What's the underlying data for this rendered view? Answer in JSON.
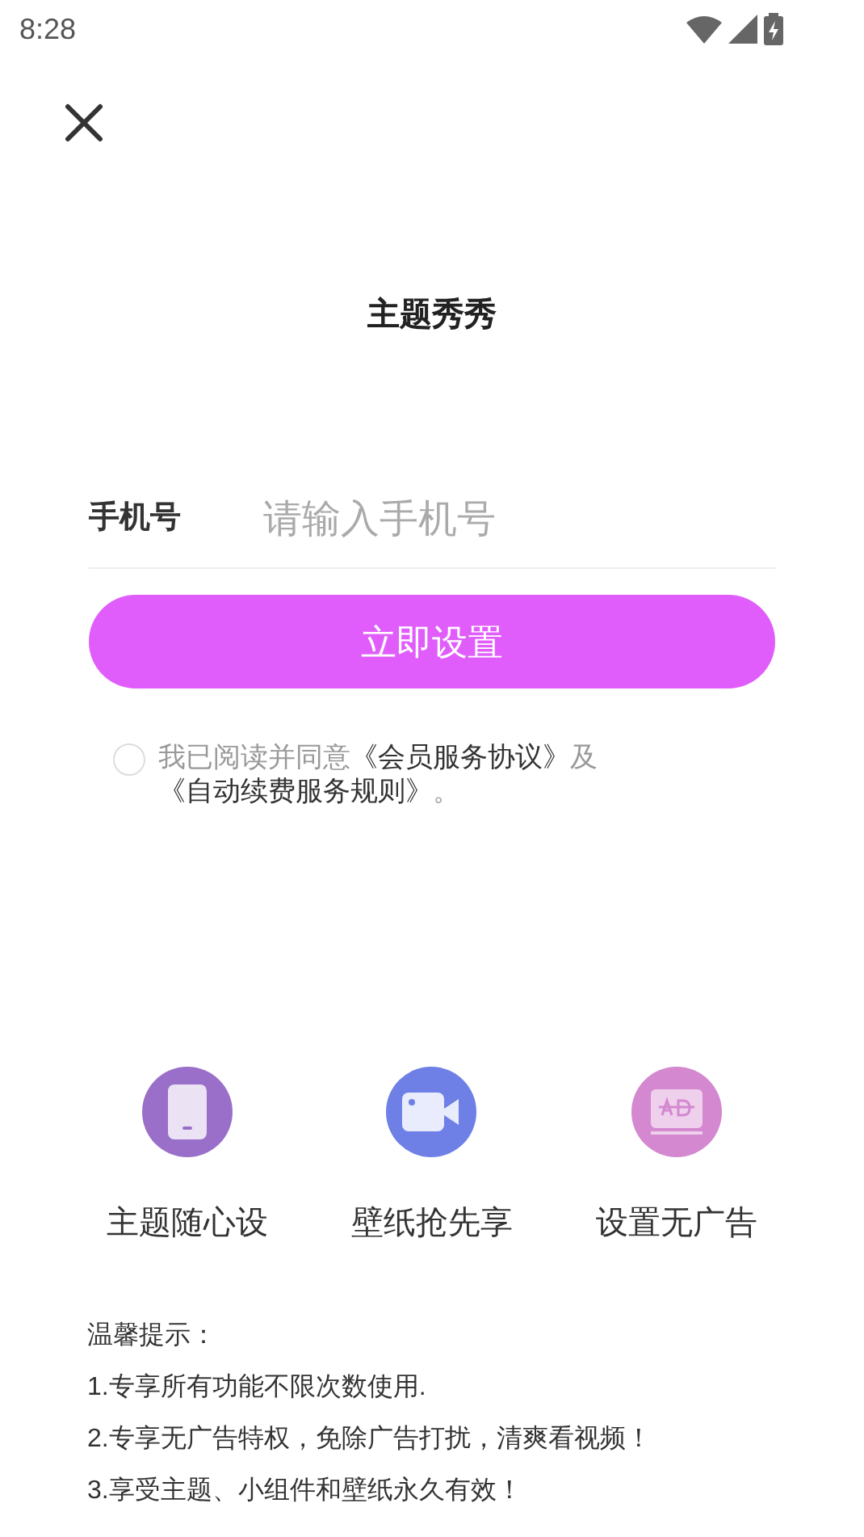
{
  "status_bar": {
    "time": "8:28"
  },
  "title": "主题秀秀",
  "phone_field": {
    "label": "手机号",
    "placeholder": "请输入手机号"
  },
  "submit_button": "立即设置",
  "agreement": {
    "checked": false,
    "parts": [
      {
        "kind": "text",
        "text": "我已阅读并同意"
      },
      {
        "kind": "link",
        "text": "《会员服务协议》"
      },
      {
        "kind": "text",
        "text": "及"
      },
      {
        "kind": "link",
        "text": "《自动续费服务规则》"
      },
      {
        "kind": "text",
        "text": "。"
      }
    ]
  },
  "features": [
    {
      "kind": "phone",
      "color": "#9a6fc9",
      "label": "主题随心设"
    },
    {
      "kind": "video",
      "color": "#6e7fe6",
      "label": "壁纸抢先享"
    },
    {
      "kind": "ad",
      "color": "#d488cf",
      "label": "设置无广告"
    }
  ],
  "tips": {
    "title": "温馨提示：",
    "items": [
      "1.专享所有功能不限次数使用.",
      "2.专享无广告特权，免除广告打扰，清爽看视频！",
      "3.享受主题、小组件和壁纸永久有效！"
    ]
  }
}
